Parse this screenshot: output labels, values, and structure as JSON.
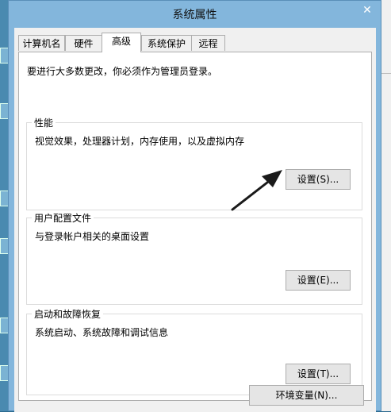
{
  "window": {
    "title": "系统属性",
    "close_glyph": "✕"
  },
  "tabs": [
    {
      "label": "计算机名"
    },
    {
      "label": "硬件"
    },
    {
      "label": "高级",
      "active": true
    },
    {
      "label": "系统保护"
    },
    {
      "label": "远程"
    }
  ],
  "advanced": {
    "intro": "要进行大多数更改，你必须作为管理员登录。",
    "performance": {
      "title": "性能",
      "description": "视觉效果，处理器计划，内存使用，以及虚拟内存",
      "button": "设置(S)..."
    },
    "user_profiles": {
      "title": "用户配置文件",
      "description": "与登录帐户相关的桌面设置",
      "button": "设置(E)..."
    },
    "startup_recovery": {
      "title": "启动和故障恢复",
      "description": "系统启动、系统故障和调试信息",
      "button": "设置(T)..."
    },
    "env_button": "环境变量(N)..."
  },
  "annotation": {
    "icon": "arrow-icon",
    "color": "#1a1a1a"
  }
}
